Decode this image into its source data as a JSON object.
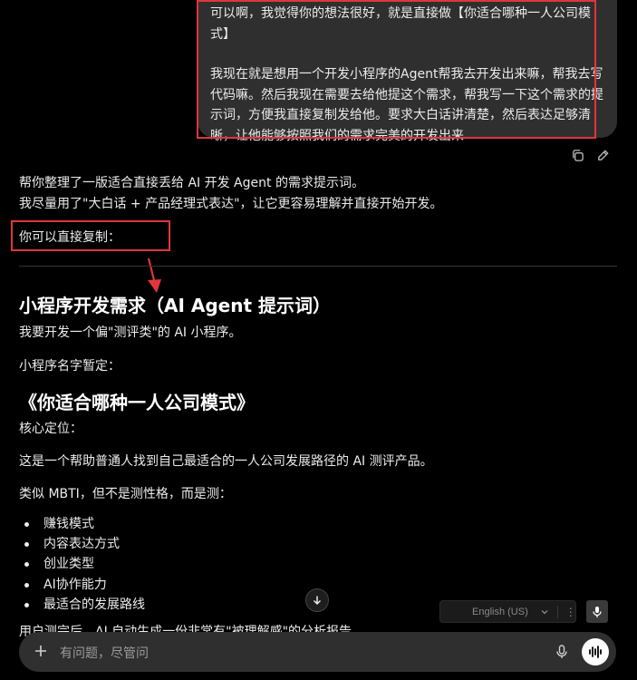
{
  "user_message": {
    "line1": "可以啊，我觉得你的想法很好，就是直接做【你适合哪种一人公司模",
    "line2": "式】",
    "line3": "我现在就是想用一个开发小程序的Agent帮我去开发出来嘛，帮我去写",
    "line4": "代码嘛。然后我现在需要去给他提这个需求，帮我写一下这个需求的提",
    "line5": "示词，方便我直接复制发给他。要求大白话讲清楚，然后表达足够清",
    "line6": "晰，让他能够按照我们的需求完美的开发出来"
  },
  "assistant": {
    "intro1": "帮你整理了一版适合直接丢给 AI 开发 Agent 的需求提示词。",
    "intro2": "我尽量用了\"大白话 + 产品经理式表达\"，让它更容易理解并直接开始开发。",
    "copy_hint": "你可以直接复制：",
    "heading": "小程序开发需求（AI Agent 提示词）",
    "p1": "我要开发一个偏\"测评类\"的 AI 小程序。",
    "p2": "小程序名字暂定：",
    "title": "《你适合哪种一人公司模式》",
    "p3": "核心定位：",
    "p4": "这是一个帮助普通人找到自己最适合的一人公司发展路径的 AI 测评产品。",
    "p5": "类似 MBTI，但不是测性格，而是测：",
    "bullets": [
      "赚钱模式",
      "内容表达方式",
      "创业类型",
      "AI协作能力",
      "最适合的发展路线"
    ],
    "partial": "用户测完后，AI 自动生成一份非常有\"被理解感\"的分析报告"
  },
  "language_widget": {
    "label": "English (US)"
  },
  "composer": {
    "placeholder": "有问题，尽管问"
  },
  "colors": {
    "annotation_red": "#e0363c",
    "bubble_bg": "#2f2f2f",
    "page_bg": "#000000"
  }
}
